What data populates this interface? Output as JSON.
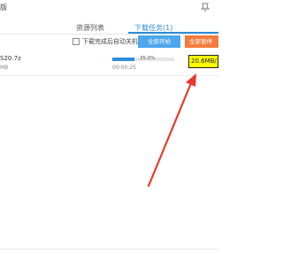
{
  "window": {
    "title_fragment": "版",
    "pin_icon": "pin-icon"
  },
  "tabs": [
    {
      "label": "资源列表",
      "active": false
    },
    {
      "label": "下载任务(1)",
      "active": true
    }
  ],
  "toolbar": {
    "auto_shutdown_label": "下载完成后自动关机",
    "auto_shutdown_checked": false,
    "start_all_label": "全部开始",
    "pause_all_label": "全部暂停"
  },
  "downloads": [
    {
      "name": "S20.7z",
      "size": "MB",
      "progress_text": "35.0%",
      "progress": 0.35,
      "elapsed": "00:00:25",
      "speed": "20.6MB/"
    }
  ],
  "colors": {
    "accent": "#2f8cd8",
    "start_button": "#4ca7ec",
    "pause_button": "#f47b3c",
    "highlight": "#ffff00",
    "annotation_arrow": "#e83a2a"
  }
}
